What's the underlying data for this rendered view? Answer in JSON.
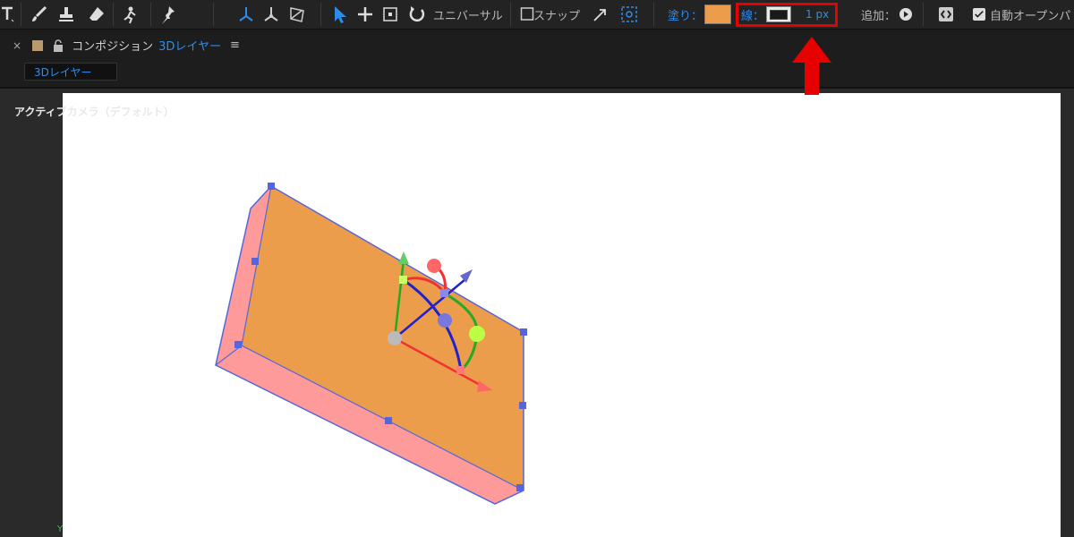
{
  "toolbar": {
    "tools": [
      "text-tool",
      "brush-tool",
      "clone-stamp-tool",
      "eraser-tool",
      "roto-brush-tool",
      "puppet-pin-tool",
      "local-axis-mode",
      "world-axis-mode",
      "view-axis-mode",
      "selection-tool",
      "pan-tool",
      "region-tool",
      "rotate-tool"
    ],
    "universal_label": "ユニバーサル",
    "snap_label": "スナップ",
    "fill_label": "塗り：",
    "fill_color": "#ec9d4b",
    "stroke_label": "線：",
    "stroke_width": "1 px",
    "add_label": "追加：",
    "auto_open_label": "自動オープンパ"
  },
  "panel": {
    "close": "×",
    "title_prefix": "コンポジション",
    "title_name": "3Dレイヤー",
    "menu": "≡",
    "comp_chip": "3Dレイヤー"
  },
  "viewer": {
    "camera_label": "アクティブカメラ（デフォルト）",
    "axis_label": "Y"
  },
  "colors": {
    "highlight": "#e60000",
    "face": "#ec9d4b",
    "side": "#ff9a9a",
    "bbox": "#5566dd"
  }
}
